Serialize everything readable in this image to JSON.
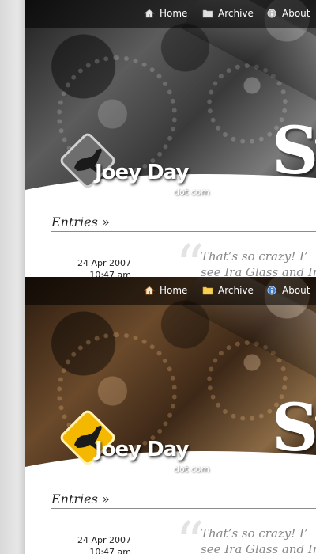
{
  "variants": [
    {
      "theme": "grayscale",
      "logo_color": "#6e6e6e",
      "nav": {
        "home": "Home",
        "archive": "Archive",
        "about": "About"
      },
      "header_letters": "Sy",
      "logo": {
        "main": "Joey Day",
        "sub": "dot com"
      },
      "entries_heading": "Entries »",
      "post": {
        "date": "24 Apr 2007",
        "time": "10:47 am",
        "excerpt_line1": "That’s so crazy! I’",
        "excerpt_line2": "see Ira Glass and Ir"
      }
    },
    {
      "theme": "color",
      "logo_color": "#f5b800",
      "nav": {
        "home": "Home",
        "archive": "Archive",
        "about": "About"
      },
      "header_letters": "Sy",
      "logo": {
        "main": "Joey Day",
        "sub": "dot com"
      },
      "entries_heading": "Entries »",
      "post": {
        "date": "24 Apr 2007",
        "time": "10:47 am",
        "excerpt_line1": "That’s so crazy! I’",
        "excerpt_line2": "see Ira Glass and Ir"
      }
    }
  ],
  "icons": {
    "home": "home-icon",
    "archive": "folder-icon",
    "about": "info-icon"
  }
}
